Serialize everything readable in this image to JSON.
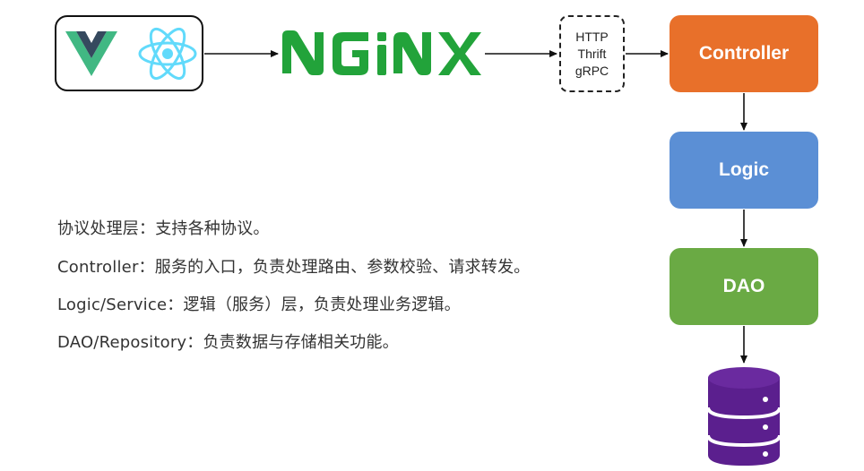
{
  "diagram": {
    "protocols": [
      "HTTP",
      "Thrift",
      "gRPC"
    ],
    "layers": {
      "controller": "Controller",
      "logic": "Logic",
      "dao": "DAO"
    },
    "descriptions": [
      "协议处理层：支持各种协议。",
      "Controller：服务的入口，负责处理路由、参数校验、请求转发。",
      "Logic/Service：逻辑（服务）层，负责处理业务逻辑。",
      "DAO/Repository：负责数据与存储相关功能。"
    ],
    "icons": {
      "frontend_1": "vue-logo-icon",
      "frontend_2": "react-logo-icon",
      "gateway": "nginx-logo",
      "storage": "database-icon"
    }
  },
  "colors": {
    "controller": "#e8702a",
    "logic": "#5b8fd5",
    "dao": "#6aaa44",
    "nginx": "#22a33a",
    "database": "#5b1f8e",
    "vue_green": "#41b883",
    "vue_dark": "#35495e",
    "react": "#61dafb"
  }
}
